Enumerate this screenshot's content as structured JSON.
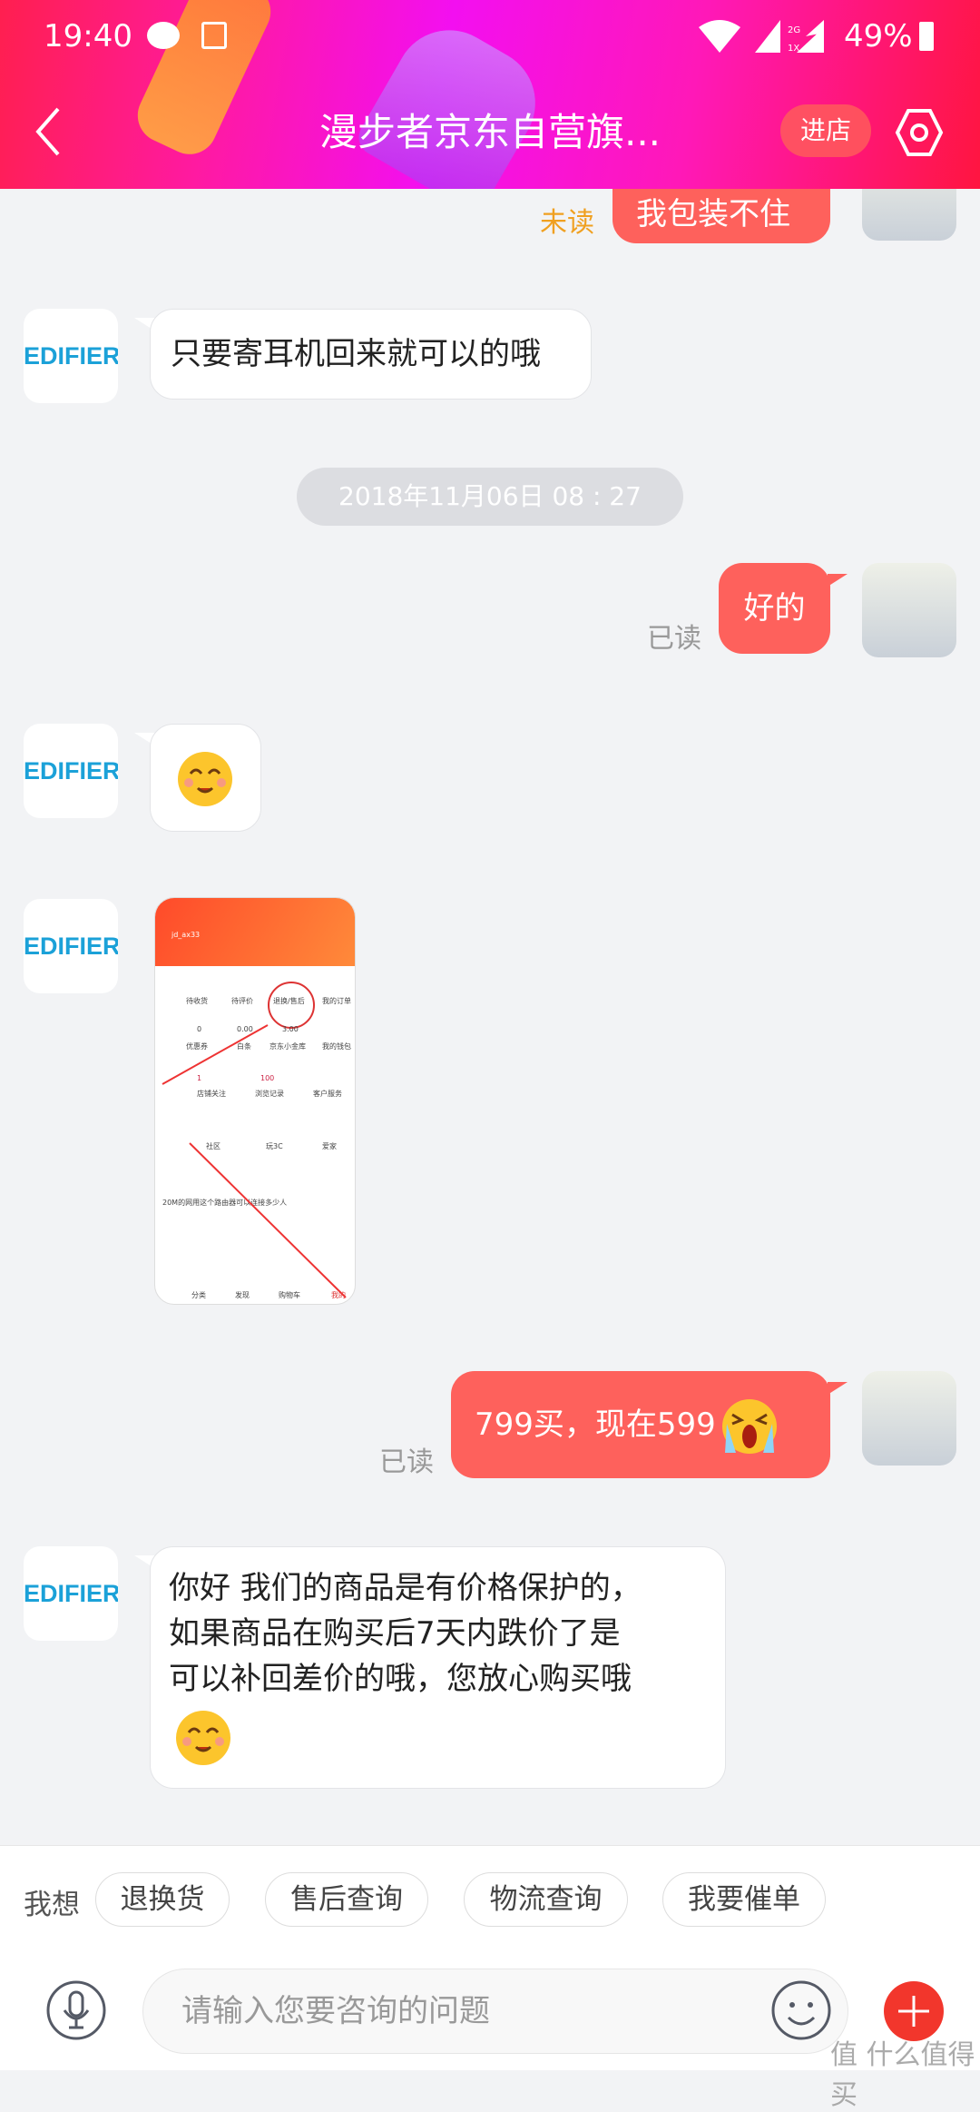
{
  "status_bar": {
    "time": "19:40",
    "battery": "49%",
    "network": "2G 1X",
    "icons": [
      "wechat-icon",
      "gallery-icon",
      "wifi-icon",
      "signal-icon",
      "battery-charging-icon"
    ]
  },
  "header": {
    "title": "漫步者京东自营旗...",
    "enter_store": "进店",
    "back_icon": "chevron-left-icon",
    "settings_icon": "hexagon-settings-icon"
  },
  "colors": {
    "accent": "#fe615c",
    "header_gradient": [
      "#ff1f4f",
      "#f30ff0",
      "#ff1540"
    ],
    "unread": "#f0a020",
    "brand_logo": "#1ba1d8"
  },
  "messages": [
    {
      "from": "me",
      "text": "我包装不住",
      "status": "未读"
    },
    {
      "from": "shop",
      "sender": "EDIFIER",
      "text": "只要寄耳机回来就可以的哦"
    },
    {
      "type": "timestamp",
      "text": "2018年11月06日  08 : 27"
    },
    {
      "from": "me",
      "text": "好的",
      "status": "已读"
    },
    {
      "from": "shop",
      "sender": "EDIFIER",
      "emoji": "smiling-face-emoji"
    },
    {
      "from": "shop",
      "sender": "EDIFIER",
      "image": {
        "labels": [
          "jd_ax33",
          "退换/售后",
          "待收货",
          "待评价",
          "我的订单",
          "优惠券",
          "白条",
          "京东小金库",
          "我的钱包",
          "店铺关注",
          "浏览记录",
          "客户服务",
          "社区",
          "玩3C",
          "爱家",
          "20M的网用这个路由器可以连接多少人",
          "分类",
          "发现",
          "购物车",
          "我的"
        ],
        "values": [
          "0",
          "0.00",
          "3.00",
          "1",
          "100"
        ]
      }
    },
    {
      "from": "me",
      "text": "799买，现在599",
      "emoji": "loudly-crying-emoji",
      "status": "已读"
    },
    {
      "from": "shop",
      "sender": "EDIFIER",
      "lines": [
        "你好  我们的商品是有价格保护的，",
        "如果商品在购买后7天内跌价了是",
        "可以补回差价的哦，您放心购买哦"
      ],
      "emoji": "smiling-face-emoji"
    }
  ],
  "quick_replies": {
    "label": "我想",
    "items": [
      "退换货",
      "售后查询",
      "物流查询",
      "我要催单"
    ]
  },
  "composer": {
    "placeholder": "请输入您要咨询的问题"
  },
  "watermark": "值 什么值得买"
}
